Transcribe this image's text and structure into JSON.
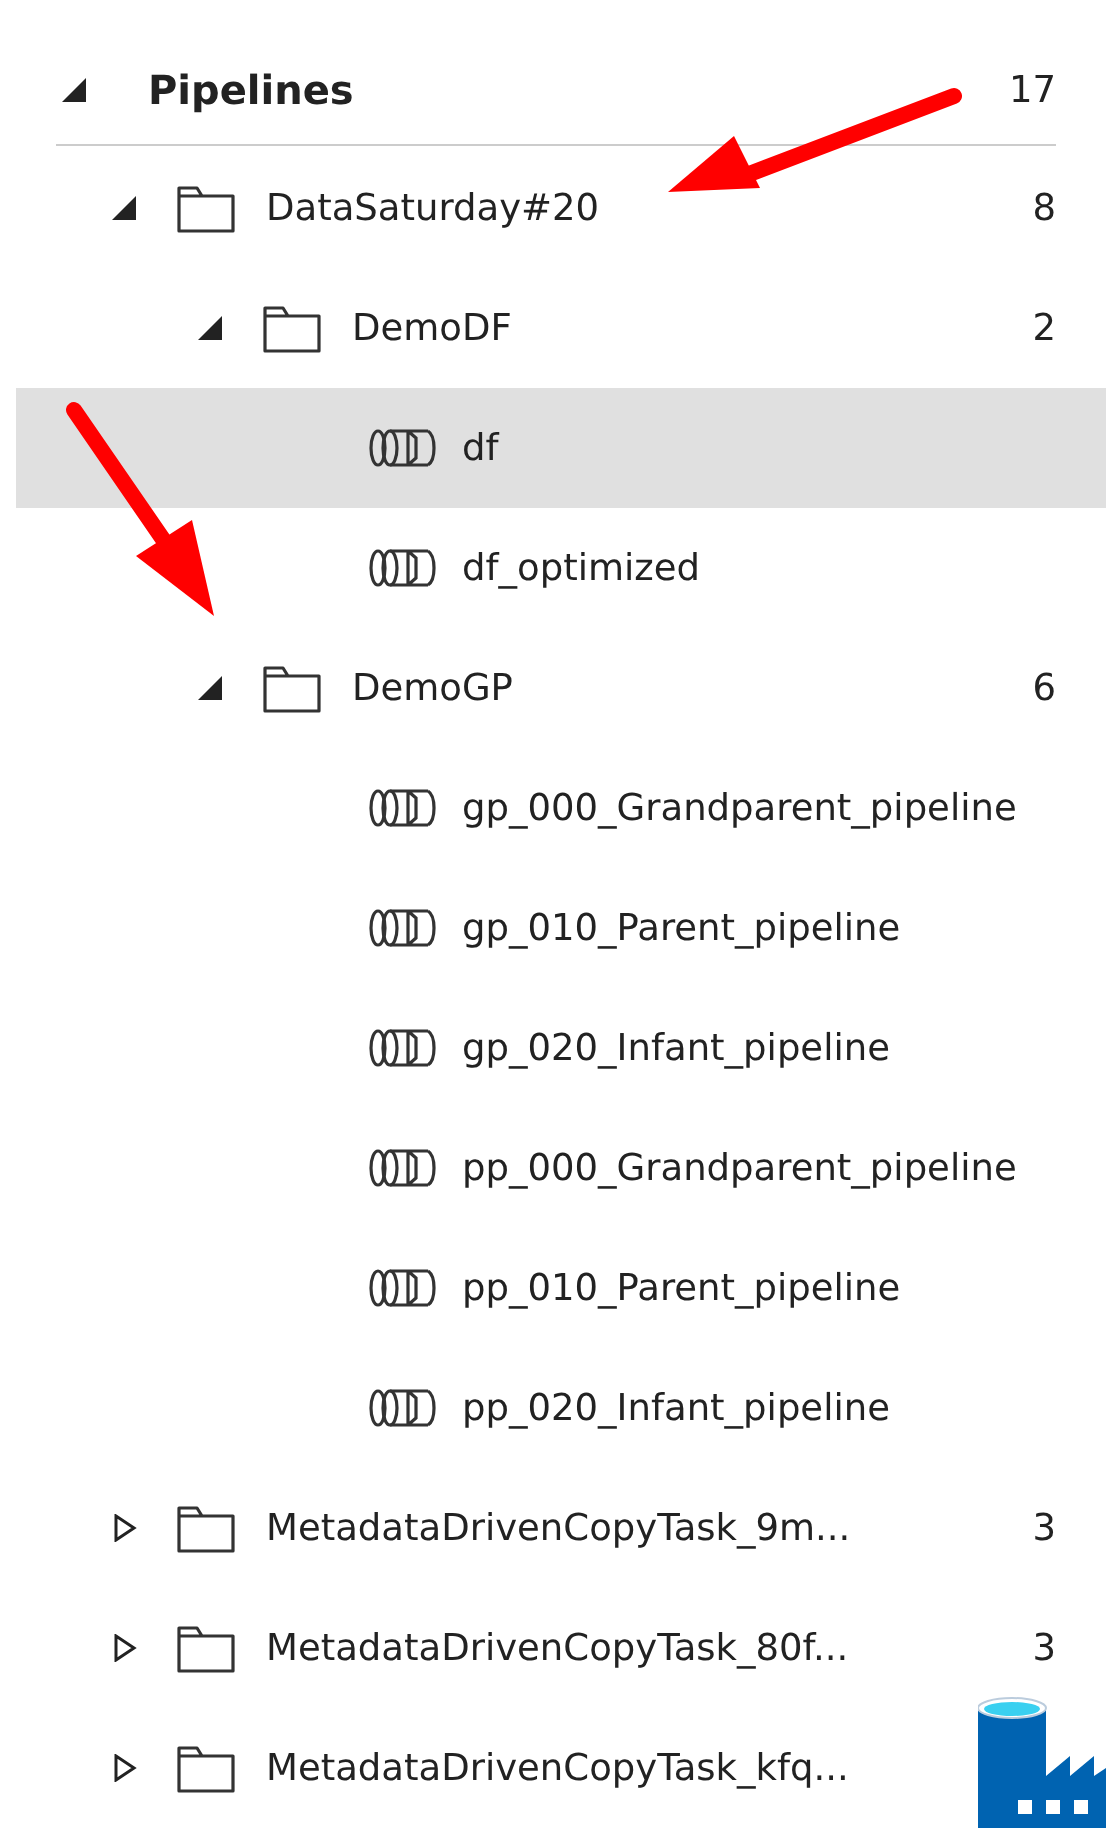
{
  "section": {
    "title": "Pipelines",
    "count": "17",
    "expanded": true
  },
  "tree": [
    {
      "kind": "folder",
      "label": "DataSaturday#20",
      "count": "8",
      "expanded": true,
      "selected": false,
      "children": [
        {
          "kind": "folder",
          "label": "DemoDF",
          "count": "2",
          "expanded": true,
          "selected": false,
          "children": [
            {
              "kind": "pipeline",
              "label": "df",
              "selected": true
            },
            {
              "kind": "pipeline",
              "label": "df_optimized",
              "selected": false
            }
          ]
        },
        {
          "kind": "folder",
          "label": "DemoGP",
          "count": "6",
          "expanded": true,
          "selected": false,
          "children": [
            {
              "kind": "pipeline",
              "label": "gp_000_Grandparent_pipeline",
              "selected": false
            },
            {
              "kind": "pipeline",
              "label": "gp_010_Parent_pipeline",
              "selected": false
            },
            {
              "kind": "pipeline",
              "label": "gp_020_Infant_pipeline",
              "selected": false
            },
            {
              "kind": "pipeline",
              "label": "pp_000_Grandparent_pipeline",
              "selected": false
            },
            {
              "kind": "pipeline",
              "label": "pp_010_Parent_pipeline",
              "selected": false
            },
            {
              "kind": "pipeline",
              "label": "pp_020_Infant_pipeline",
              "selected": false
            }
          ]
        }
      ]
    },
    {
      "kind": "folder",
      "label": "MetadataDrivenCopyTask_9m...",
      "count": "3",
      "expanded": false,
      "selected": false
    },
    {
      "kind": "folder",
      "label": "MetadataDrivenCopyTask_80f...",
      "count": "3",
      "expanded": false,
      "selected": false
    },
    {
      "kind": "folder",
      "label": "MetadataDrivenCopyTask_kfq...",
      "expanded": false,
      "selected": false
    }
  ]
}
